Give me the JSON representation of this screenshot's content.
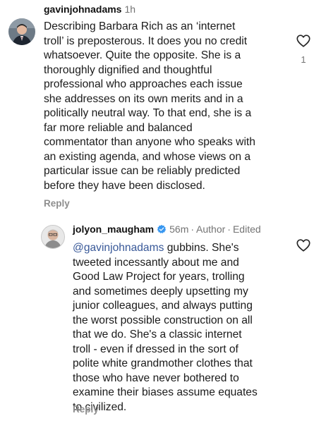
{
  "comments": [
    {
      "username": "gavinjohnadams",
      "time": "1h",
      "lines": [
        "Describing Barbara Rich as an ‘internet",
        "troll’ is preposterous. It does you no credit",
        "whatsoever. Quite the opposite. She is a",
        "thoroughly dignified and thoughtful",
        "professional who approaches each issue",
        "she addresses on its own merits and in a",
        "politically neutral way. To that end, she is a",
        "far more reliable and balanced",
        "commentator than anyone who speaks with",
        "an existing agenda, and whose views on a",
        "particular issue can be reliably predicted",
        "before they have been disclosed."
      ],
      "reply_label": "Reply",
      "like_count": "1",
      "like_icon": "heart-outline-icon"
    },
    {
      "username": "jolyon_maugham",
      "verified_icon": "verified-badge-icon",
      "time": "56m",
      "separator": "·",
      "author_label": "Author",
      "edited_label": "Edited",
      "mention": "@gavinjohnadams",
      "first_line_rest": " gubbins. She's",
      "lines": [
        "tweeted incessantly about me and",
        "Good Law Project for years, trolling",
        "and sometimes deeply upsetting my",
        "junior colleagues, and always putting",
        "the worst possible construction on all",
        "that we do. She's a classic internet",
        "troll - even if dressed in the sort of",
        "polite white grandmother clothes that",
        "those who have never bothered to",
        "examine their biases assume equates",
        "to civilized."
      ],
      "reply_label": "Reply",
      "like_icon": "heart-outline-icon"
    }
  ],
  "colors": {
    "mention": "#385898",
    "verified": "#3897f0",
    "meta": "#737373"
  }
}
